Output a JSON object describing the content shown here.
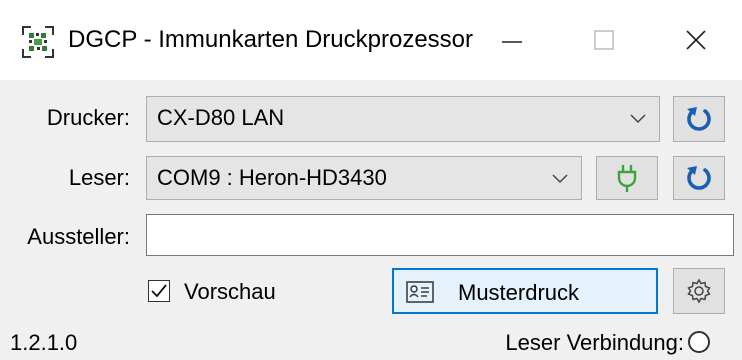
{
  "window": {
    "title": "DGCP - Immunkarten Druckprozessor",
    "icon": "qr-badge-icon",
    "controls": {
      "minimize": "–",
      "maximize": "□",
      "close": "×"
    }
  },
  "form": {
    "printer_label": "Drucker:",
    "printer_value": "CX-D80 LAN",
    "reader_label": "Leser:",
    "reader_value": "COM9 : Heron-HD3430",
    "issuer_label": "Aussteller:",
    "issuer_value": "",
    "preview_label": "Vorschau",
    "preview_checked": true,
    "sample_print_label": "Musterdruck"
  },
  "status": {
    "version": "1.2.1.0",
    "reader_connection_label": "Leser Verbindung:"
  },
  "colors": {
    "accent": "#0078d7",
    "refresh_icon": "#1a5fb4",
    "plug_icon": "#3da33d"
  }
}
